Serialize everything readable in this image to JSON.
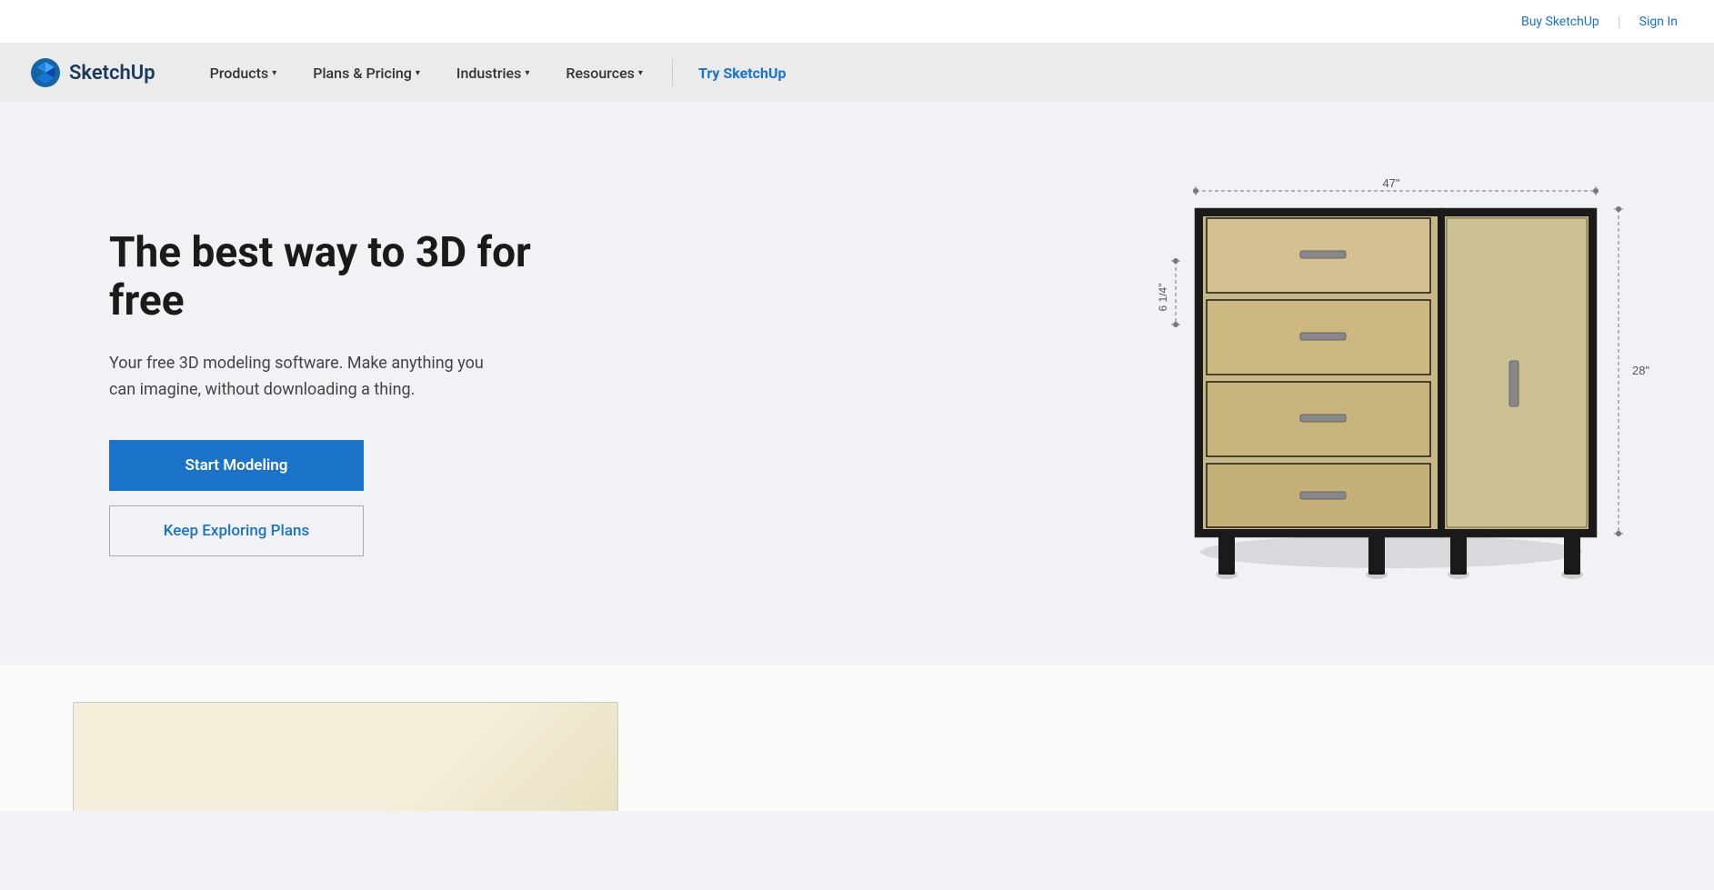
{
  "topbar": {
    "buy_link": "Buy SketchUp",
    "signin_link": "Sign In"
  },
  "navbar": {
    "logo_text": "SketchUp",
    "products_label": "Products",
    "plans_label": "Plans & Pricing",
    "industries_label": "Industries",
    "resources_label": "Resources",
    "cta_label": "Try SketchUp"
  },
  "hero": {
    "title": "The best way to 3D for free",
    "subtitle": "Your free 3D modeling software. Make anything you can imagine, without downloading a thing.",
    "btn_primary": "Start Modeling",
    "btn_secondary": "Keep Exploring Plans"
  },
  "dresser": {
    "dim_width": "47\"",
    "dim_height": "28\"",
    "dim_drawer": "6 1/4\""
  }
}
